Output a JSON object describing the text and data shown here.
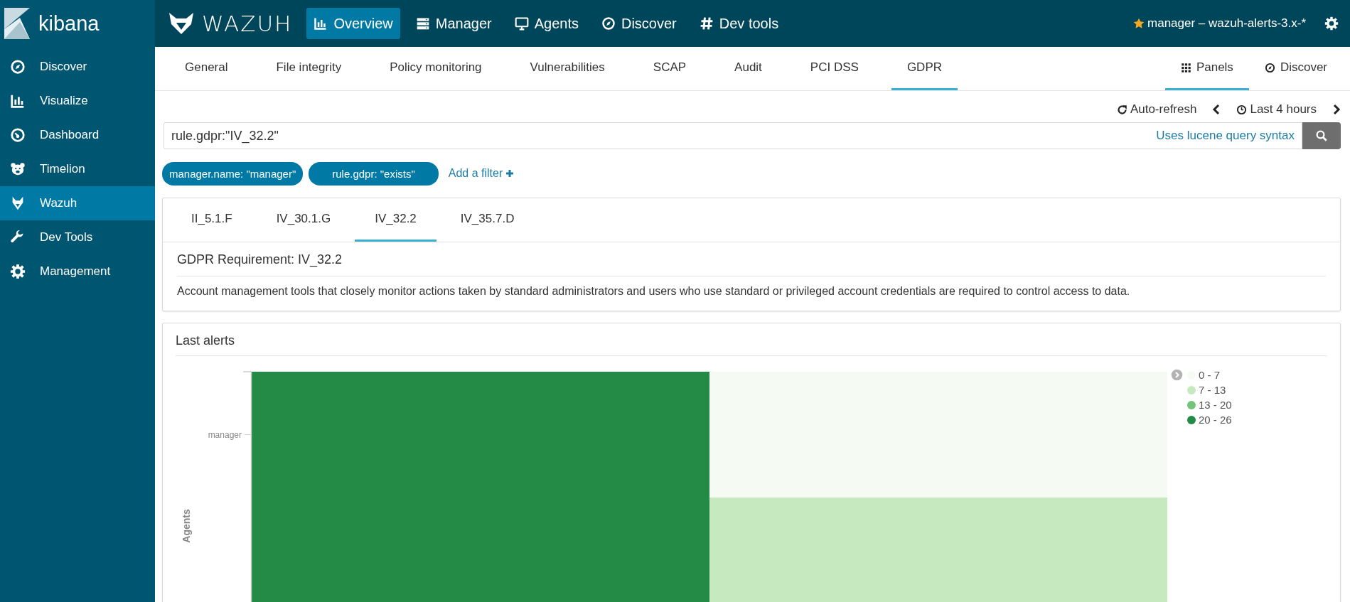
{
  "sidebar": {
    "brand": "kibana",
    "items": [
      {
        "label": "Discover",
        "selected": false
      },
      {
        "label": "Visualize",
        "selected": false
      },
      {
        "label": "Dashboard",
        "selected": false
      },
      {
        "label": "Timelion",
        "selected": false
      },
      {
        "label": "Wazuh",
        "selected": true
      },
      {
        "label": "Dev Tools",
        "selected": false
      },
      {
        "label": "Management",
        "selected": false
      }
    ]
  },
  "header": {
    "brand": "WAZUH",
    "nav": [
      {
        "label": "Overview",
        "selected": true
      },
      {
        "label": "Manager",
        "selected": false
      },
      {
        "label": "Agents",
        "selected": false
      },
      {
        "label": "Discover",
        "selected": false
      },
      {
        "label": "Dev tools",
        "selected": false
      }
    ],
    "pattern": "manager – wazuh-alerts-3.x-*"
  },
  "tabs": {
    "items": [
      {
        "label": "General",
        "selected": false
      },
      {
        "label": "File integrity",
        "selected": false
      },
      {
        "label": "Policy monitoring",
        "selected": false
      },
      {
        "label": "Vulnerabilities",
        "selected": false
      },
      {
        "label": "SCAP",
        "selected": false
      },
      {
        "label": "Audit",
        "selected": false
      },
      {
        "label": "PCI DSS",
        "selected": false
      },
      {
        "label": "GDPR",
        "selected": true
      }
    ],
    "right": [
      {
        "label": "Panels",
        "selected": true
      },
      {
        "label": "Discover",
        "selected": false
      }
    ]
  },
  "time": {
    "refresh": "Auto-refresh",
    "range": "Last 4 hours"
  },
  "search": {
    "value": "rule.gdpr:\"IV_32.2\"",
    "hint": "Uses lucene query syntax"
  },
  "filters": [
    {
      "label": "manager.name: \"manager\""
    },
    {
      "label": "rule.gdpr: \"exists\""
    }
  ],
  "add_filter": "Add a filter",
  "requirement": {
    "tabs": [
      {
        "label": "II_5.1.F",
        "selected": false
      },
      {
        "label": "IV_30.1.G",
        "selected": false
      },
      {
        "label": "IV_32.2",
        "selected": true
      },
      {
        "label": "IV_35.7.D",
        "selected": false
      }
    ],
    "title": "GDPR Requirement: IV_32.2",
    "description": "Account management tools that closely monitor actions taken by standard administrators and users who use standard or privileged account credentials are required to control access to data."
  },
  "last_alerts": {
    "title": "Last alerts",
    "y_axis_title": "Agents",
    "y_labels": [
      "manager"
    ],
    "cells": [
      [
        {
          "color": "#248b46"
        },
        {
          "color": "#f5faf3"
        }
      ],
      [
        {
          "color": "#248b46"
        },
        {
          "color": "#c7e9c0"
        }
      ]
    ],
    "legend": [
      {
        "label": "0 - 7",
        "color": "#f5faf3"
      },
      {
        "label": "7 - 13",
        "color": "#c7e9c0"
      },
      {
        "label": "13 - 20",
        "color": "#73c476"
      },
      {
        "label": "20 - 26",
        "color": "#248b46"
      }
    ]
  }
}
